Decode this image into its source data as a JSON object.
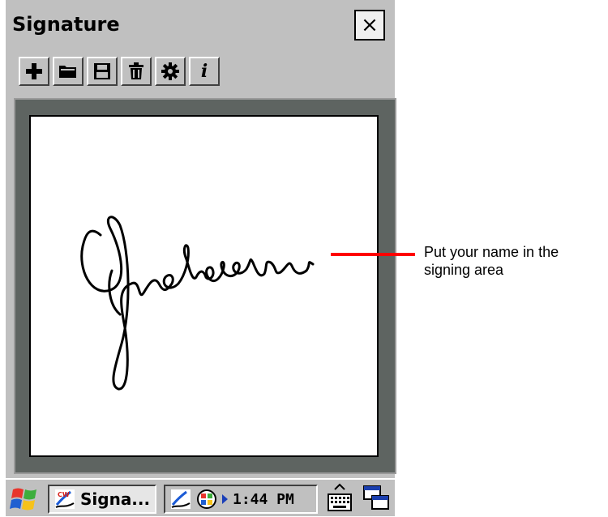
{
  "window": {
    "title": "Signature",
    "close_label": "×"
  },
  "toolbar": {
    "buttons": [
      {
        "icon": "plus-icon"
      },
      {
        "icon": "folder-open-icon"
      },
      {
        "icon": "save-icon"
      },
      {
        "icon": "trash-icon"
      },
      {
        "icon": "gear-icon"
      },
      {
        "icon": "info-icon",
        "label": "i"
      }
    ]
  },
  "canvas": {
    "signature_text": "Jackson",
    "frame_color": "#5e6461"
  },
  "taskbar": {
    "task_label": "Signa...",
    "clock": "1:44 PM",
    "icons": [
      "windows-start-icon",
      "signature-app-icon",
      "network-icon",
      "keyboard-icon",
      "window-switch-icon"
    ]
  },
  "annotation": {
    "line1": "Put your name in the",
    "line2": "signing area",
    "line_color": "#ff0000"
  }
}
